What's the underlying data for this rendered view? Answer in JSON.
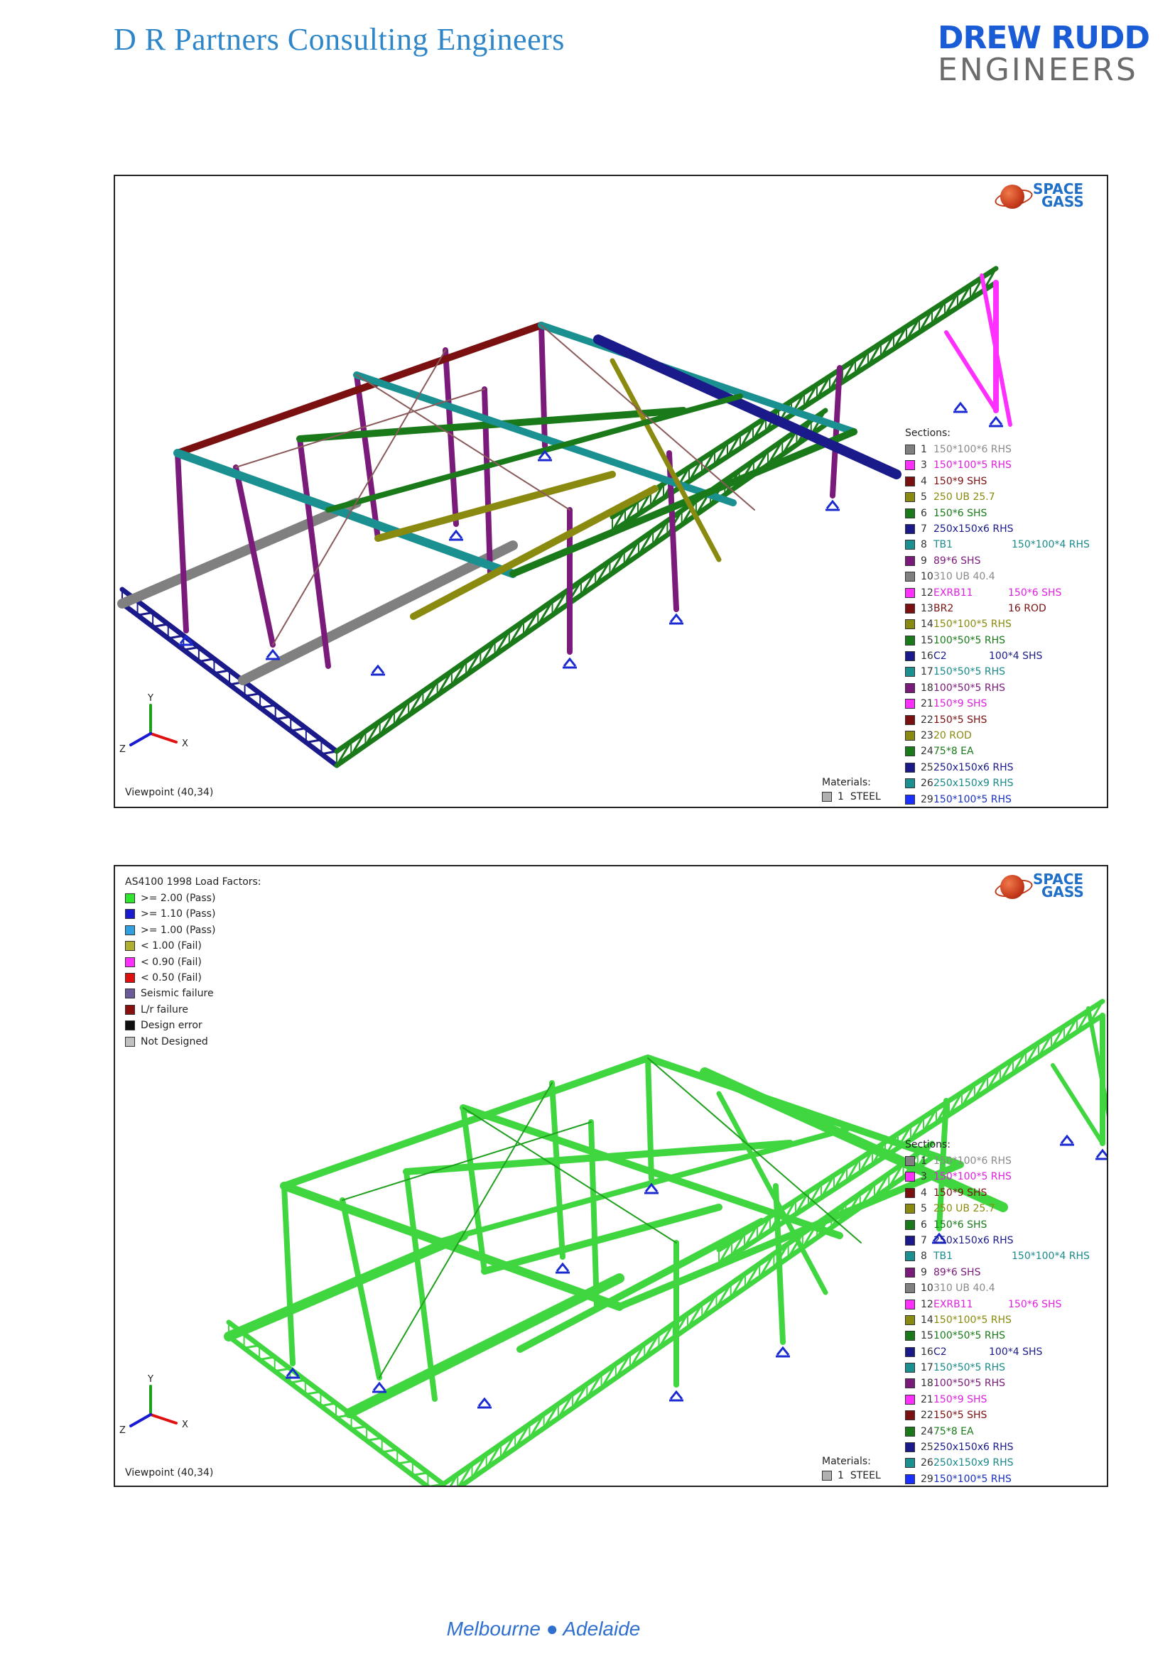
{
  "header": {
    "firm_name": "D R Partners Consulting Engineers",
    "logo_line1": "DREW RUDD",
    "logo_line2": "ENGINEERS"
  },
  "space_gass_logo": {
    "line1": "SPACE",
    "line2": "GASS"
  },
  "sections_label": "Sections:",
  "materials_label": "Materials:",
  "material": {
    "num": "1",
    "name": "STEEL",
    "color": "#b0b0b0"
  },
  "viewpoint": "Viewpoint (40,34)",
  "axes": {
    "x": "X",
    "y": "Y",
    "z": "Z"
  },
  "sections": [
    {
      "num": "1",
      "name": "150*100*6 RHS",
      "extra": "",
      "color": "#808080",
      "text": "#8a8a8a"
    },
    {
      "num": "3",
      "name": "150*100*5 RHS",
      "extra": "",
      "color": "#ff30ff",
      "text": "#e020e0"
    },
    {
      "num": "4",
      "name": "150*9 SHS",
      "extra": "",
      "color": "#7a1010",
      "text": "#7a1010"
    },
    {
      "num": "5",
      "name": "250 UB 25.7",
      "extra": "",
      "color": "#8a8a10",
      "text": "#8a8a10"
    },
    {
      "num": "6",
      "name": "150*6 SHS",
      "extra": "",
      "color": "#1a7a1a",
      "text": "#1a7a1a"
    },
    {
      "num": "7",
      "name": "250x150x6 RHS",
      "extra": "",
      "color": "#1a1a8a",
      "text": "#1a1a8a"
    },
    {
      "num": "8",
      "name": "TB1",
      "extra": "150*100*4 RHS",
      "color": "#1a9090",
      "text": "#1a8a8a"
    },
    {
      "num": "9",
      "name": "89*6 SHS",
      "extra": "",
      "color": "#7a1a7a",
      "text": "#7a1a7a"
    },
    {
      "num": "10",
      "name": "310 UB 40.4",
      "extra": "",
      "color": "#808080",
      "text": "#8a8a8a"
    },
    {
      "num": "12",
      "name": "EXRB11",
      "extra": "150*6 SHS",
      "color": "#ff30ff",
      "text": "#e020e0"
    },
    {
      "num": "13",
      "name": "BR2",
      "extra": "16 ROD",
      "color": "#7a1010",
      "text": "#7a1010"
    },
    {
      "num": "14",
      "name": "150*100*5 RHS",
      "extra": "",
      "color": "#8a8a10",
      "text": "#8a8a10"
    },
    {
      "num": "15",
      "name": "100*50*5 RHS",
      "extra": "",
      "color": "#1a7a1a",
      "text": "#1a7a1a"
    },
    {
      "num": "16",
      "name": "C2",
      "extra": "100*4 SHS",
      "color": "#1a1a8a",
      "text": "#1a1a8a"
    },
    {
      "num": "17",
      "name": "150*50*5 RHS",
      "extra": "",
      "color": "#1a9090",
      "text": "#1a8a8a"
    },
    {
      "num": "18",
      "name": "100*50*5 RHS",
      "extra": "",
      "color": "#7a1a7a",
      "text": "#7a1a7a"
    },
    {
      "num": "21",
      "name": "150*9 SHS",
      "extra": "",
      "color": "#ff30ff",
      "text": "#e020e0"
    },
    {
      "num": "22",
      "name": "150*5 SHS",
      "extra": "",
      "color": "#7a1010",
      "text": "#7a1010"
    },
    {
      "num": "23",
      "name": "20 ROD",
      "extra": "",
      "color": "#8a8a10",
      "text": "#8a8a10"
    },
    {
      "num": "24",
      "name": "75*8 EA",
      "extra": "",
      "color": "#1a7a1a",
      "text": "#1a7a1a"
    },
    {
      "num": "25",
      "name": "250x150x6 RHS",
      "extra": "",
      "color": "#1a1a8a",
      "text": "#1a1a8a"
    },
    {
      "num": "26",
      "name": "250x150x9 RHS",
      "extra": "",
      "color": "#1a9090",
      "text": "#1a8a8a"
    },
    {
      "num": "29",
      "name": "150*100*5 RHS",
      "extra": "",
      "color": "#1a30ff",
      "text": "#1a30c0"
    }
  ],
  "sections2": [
    {
      "num": "1",
      "name": "150*100*6 RHS",
      "extra": "",
      "color": "#808080",
      "text": "#8a8a8a"
    },
    {
      "num": "3",
      "name": "150*100*5 RHS",
      "extra": "",
      "color": "#ff30ff",
      "text": "#e020e0"
    },
    {
      "num": "4",
      "name": "150*9 SHS",
      "extra": "",
      "color": "#7a1010",
      "text": "#7a1010"
    },
    {
      "num": "5",
      "name": "250 UB 25.7",
      "extra": "",
      "color": "#8a8a10",
      "text": "#8a8a10"
    },
    {
      "num": "6",
      "name": "150*6 SHS",
      "extra": "",
      "color": "#1a7a1a",
      "text": "#1a7a1a"
    },
    {
      "num": "7",
      "name": "250x150x6 RHS",
      "extra": "",
      "color": "#1a1a8a",
      "text": "#1a1a8a"
    },
    {
      "num": "8",
      "name": "TB1",
      "extra": "150*100*4 RHS",
      "color": "#1a9090",
      "text": "#1a8a8a"
    },
    {
      "num": "9",
      "name": "89*6 SHS",
      "extra": "",
      "color": "#7a1a7a",
      "text": "#7a1a7a"
    },
    {
      "num": "10",
      "name": "310 UB 40.4",
      "extra": "",
      "color": "#808080",
      "text": "#8a8a8a"
    },
    {
      "num": "12",
      "name": "EXRB11",
      "extra": "150*6 SHS",
      "color": "#ff30ff",
      "text": "#e020e0"
    },
    {
      "num": "14",
      "name": "150*100*5 RHS",
      "extra": "",
      "color": "#8a8a10",
      "text": "#8a8a10"
    },
    {
      "num": "15",
      "name": "100*50*5 RHS",
      "extra": "",
      "color": "#1a7a1a",
      "text": "#1a7a1a"
    },
    {
      "num": "16",
      "name": "C2",
      "extra": "100*4 SHS",
      "color": "#1a1a8a",
      "text": "#1a1a8a"
    },
    {
      "num": "17",
      "name": "150*50*5 RHS",
      "extra": "",
      "color": "#1a9090",
      "text": "#1a8a8a"
    },
    {
      "num": "18",
      "name": "100*50*5 RHS",
      "extra": "",
      "color": "#7a1a7a",
      "text": "#7a1a7a"
    },
    {
      "num": "21",
      "name": "150*9 SHS",
      "extra": "",
      "color": "#ff30ff",
      "text": "#e020e0"
    },
    {
      "num": "22",
      "name": "150*5 SHS",
      "extra": "",
      "color": "#7a1010",
      "text": "#7a1010"
    },
    {
      "num": "24",
      "name": "75*8 EA",
      "extra": "",
      "color": "#1a7a1a",
      "text": "#1a7a1a"
    },
    {
      "num": "25",
      "name": "250x150x6 RHS",
      "extra": "",
      "color": "#1a1a8a",
      "text": "#1a1a8a"
    },
    {
      "num": "26",
      "name": "250x150x9 RHS",
      "extra": "",
      "color": "#1a9090",
      "text": "#1a8a8a"
    },
    {
      "num": "29",
      "name": "150*100*5 RHS",
      "extra": "",
      "color": "#1a30ff",
      "text": "#1a30c0"
    }
  ],
  "load_factors": {
    "title": "AS4100 1998 Load Factors:",
    "items": [
      {
        "label": ">= 2.00 (Pass)",
        "color": "#2ee62e"
      },
      {
        "label": ">= 1.10 (Pass)",
        "color": "#1a1ad0"
      },
      {
        "label": ">= 1.00 (Pass)",
        "color": "#30a0e0"
      },
      {
        "label": "< 1.00 (Fail)",
        "color": "#b0b030"
      },
      {
        "label": "< 0.90 (Fail)",
        "color": "#ff30ff"
      },
      {
        "label": "< 0.50 (Fail)",
        "color": "#e01010"
      },
      {
        "label": "Seismic failure",
        "color": "#6a5a9a"
      },
      {
        "label": "L/r failure",
        "color": "#8a1010"
      },
      {
        "label": "Design error",
        "color": "#101010"
      },
      {
        "label": "Not Designed",
        "color": "#c0c0c0"
      }
    ]
  },
  "footer": "Melbourne ● Adelaide"
}
